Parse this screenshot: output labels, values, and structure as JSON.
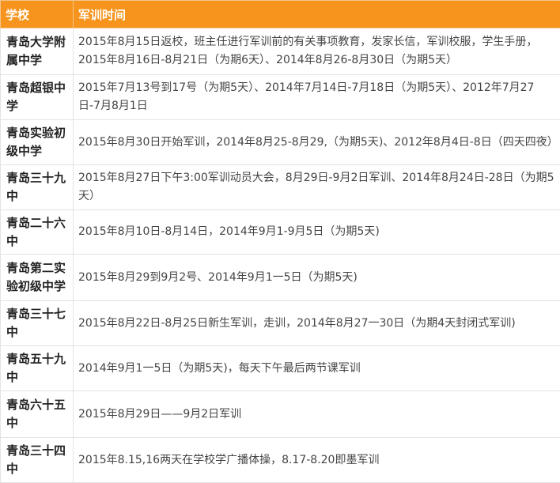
{
  "header": {
    "school": "学校",
    "time": "军训时间"
  },
  "rows": [
    {
      "school": "青岛大学附属中学",
      "time": "2015年8月15日返校，班主任进行军训前的有关事项教育，发家长信，军训校服，学生手册，2015年8月16日-8月21日（为期6天）、2014年8月26-8月30日（为期5天）"
    },
    {
      "school": "青岛超银中学",
      "time": "2015年7月13号到17号（为期5天）、2014年7月14日-7月18日（为期5天）、2012年7月27日-7月8月1日"
    },
    {
      "school": "青岛实验初级中学",
      "time": "2015年8月30日开始军训，2014年8月25-8月29,（为期5天)、2012年8月4日-8日（四天四夜）"
    },
    {
      "school": "青岛三十九中",
      "time": "2015年8月27日下午3:00军训动员大会，8月29日-9月2日军训、2014年8月24日-28日（为期5天）"
    },
    {
      "school": "青岛二十六中",
      "time": "2015年8月10日-8月14日，2014年9月1-9月5日（为期5天)"
    },
    {
      "school": "青岛第二实验初级中学",
      "time": "2015年8月29到9月2号、2014年9月1一5日（为期5天)"
    },
    {
      "school": "青岛三十七中",
      "time": "2015年8月22日-8月25日新生军训，走训，2014年8月27一30日（为期4天封闭式军训)"
    },
    {
      "school": "青岛五十九中",
      "time": "2014年9月1一5日（为期5天)，每天下午最后两节课军训"
    },
    {
      "school": "青岛六十五中",
      "time": "2015年8月29日——9月2日军训"
    },
    {
      "school": "青岛三十四中",
      "time": "2015年8.15,16两天在学校学广播体操，8.17-8.20即墨军训"
    }
  ]
}
